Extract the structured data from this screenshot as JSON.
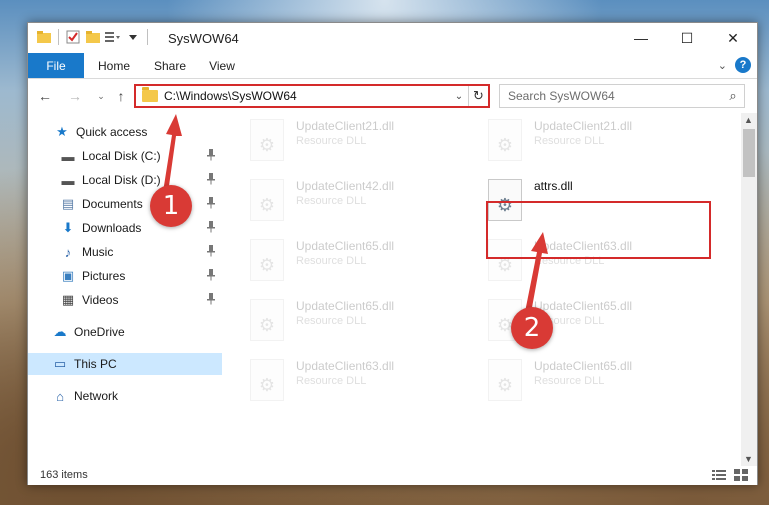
{
  "window": {
    "title": "SysWOW64",
    "minimize_glyph": "—",
    "maximize_glyph": "☐",
    "close_glyph": "✕"
  },
  "ribbon": {
    "tabs": [
      "File",
      "Home",
      "Share",
      "View"
    ],
    "help_glyph": "?",
    "collapse_glyph": "⌄"
  },
  "address_bar": {
    "path": "C:\\Windows\\SysWOW64",
    "dropdown_glyph": "⌄",
    "refresh_glyph": "↻"
  },
  "search": {
    "placeholder": "Search SysWOW64",
    "icon_glyph": "⌕"
  },
  "nav_buttons": {
    "back_glyph": "←",
    "forward_glyph": "→",
    "recent_glyph": "⌄",
    "up_glyph": "↑"
  },
  "nav_pane": {
    "items": [
      {
        "label": "Quick access",
        "icon": "★",
        "pinned": false
      },
      {
        "label": "Local Disk (C:)",
        "icon": "▬",
        "pinned": true
      },
      {
        "label": "Local Disk (D:)",
        "icon": "▬",
        "pinned": true
      },
      {
        "label": "Documents",
        "icon": "▤",
        "pinned": true
      },
      {
        "label": "Downloads",
        "icon": "⬇",
        "pinned": true
      },
      {
        "label": "Music",
        "icon": "♪",
        "pinned": true
      },
      {
        "label": "Pictures",
        "icon": "▣",
        "pinned": true
      },
      {
        "label": "Videos",
        "icon": "▦",
        "pinned": true
      },
      {
        "label": "OneDrive",
        "icon": "☁",
        "pinned": false
      },
      {
        "label": "This PC",
        "icon": "▭",
        "pinned": false
      },
      {
        "label": "Network",
        "icon": "⌂",
        "pinned": false
      }
    ],
    "pin_glyph": "📌"
  },
  "files": [
    {
      "name": "UpdateClient21.dll",
      "type": "Resource DLL",
      "faded": true
    },
    {
      "name": "UpdateClient21.dll",
      "type": "Resource DLL",
      "faded": true
    },
    {
      "name": "UpdateClient42.dll",
      "type": "Resource DLL",
      "faded": true
    },
    {
      "name": "attrs.dll",
      "type": "",
      "faded": false
    },
    {
      "name": "UpdateClient65.dll",
      "type": "Resource DLL",
      "faded": true
    },
    {
      "name": "UpdateClient63.dll",
      "type": "Resource DLL",
      "faded": true
    },
    {
      "name": "UpdateClient65.dll",
      "type": "Resource DLL",
      "faded": true
    },
    {
      "name": "UpdateClient65.dll",
      "type": "Resource DLL",
      "faded": true
    },
    {
      "name": "UpdateClient63.dll",
      "type": "Resource DLL",
      "faded": true
    },
    {
      "name": "UpdateClient65.dll",
      "type": "Resource DLL",
      "faded": true
    }
  ],
  "status": {
    "item_count": "163 items"
  },
  "annotations": {
    "step1": "1",
    "step2": "2"
  },
  "colors": {
    "accent": "#1979ca",
    "highlight": "#d42a2a",
    "badge": "#d93a35",
    "selection": "#cce8ff"
  }
}
